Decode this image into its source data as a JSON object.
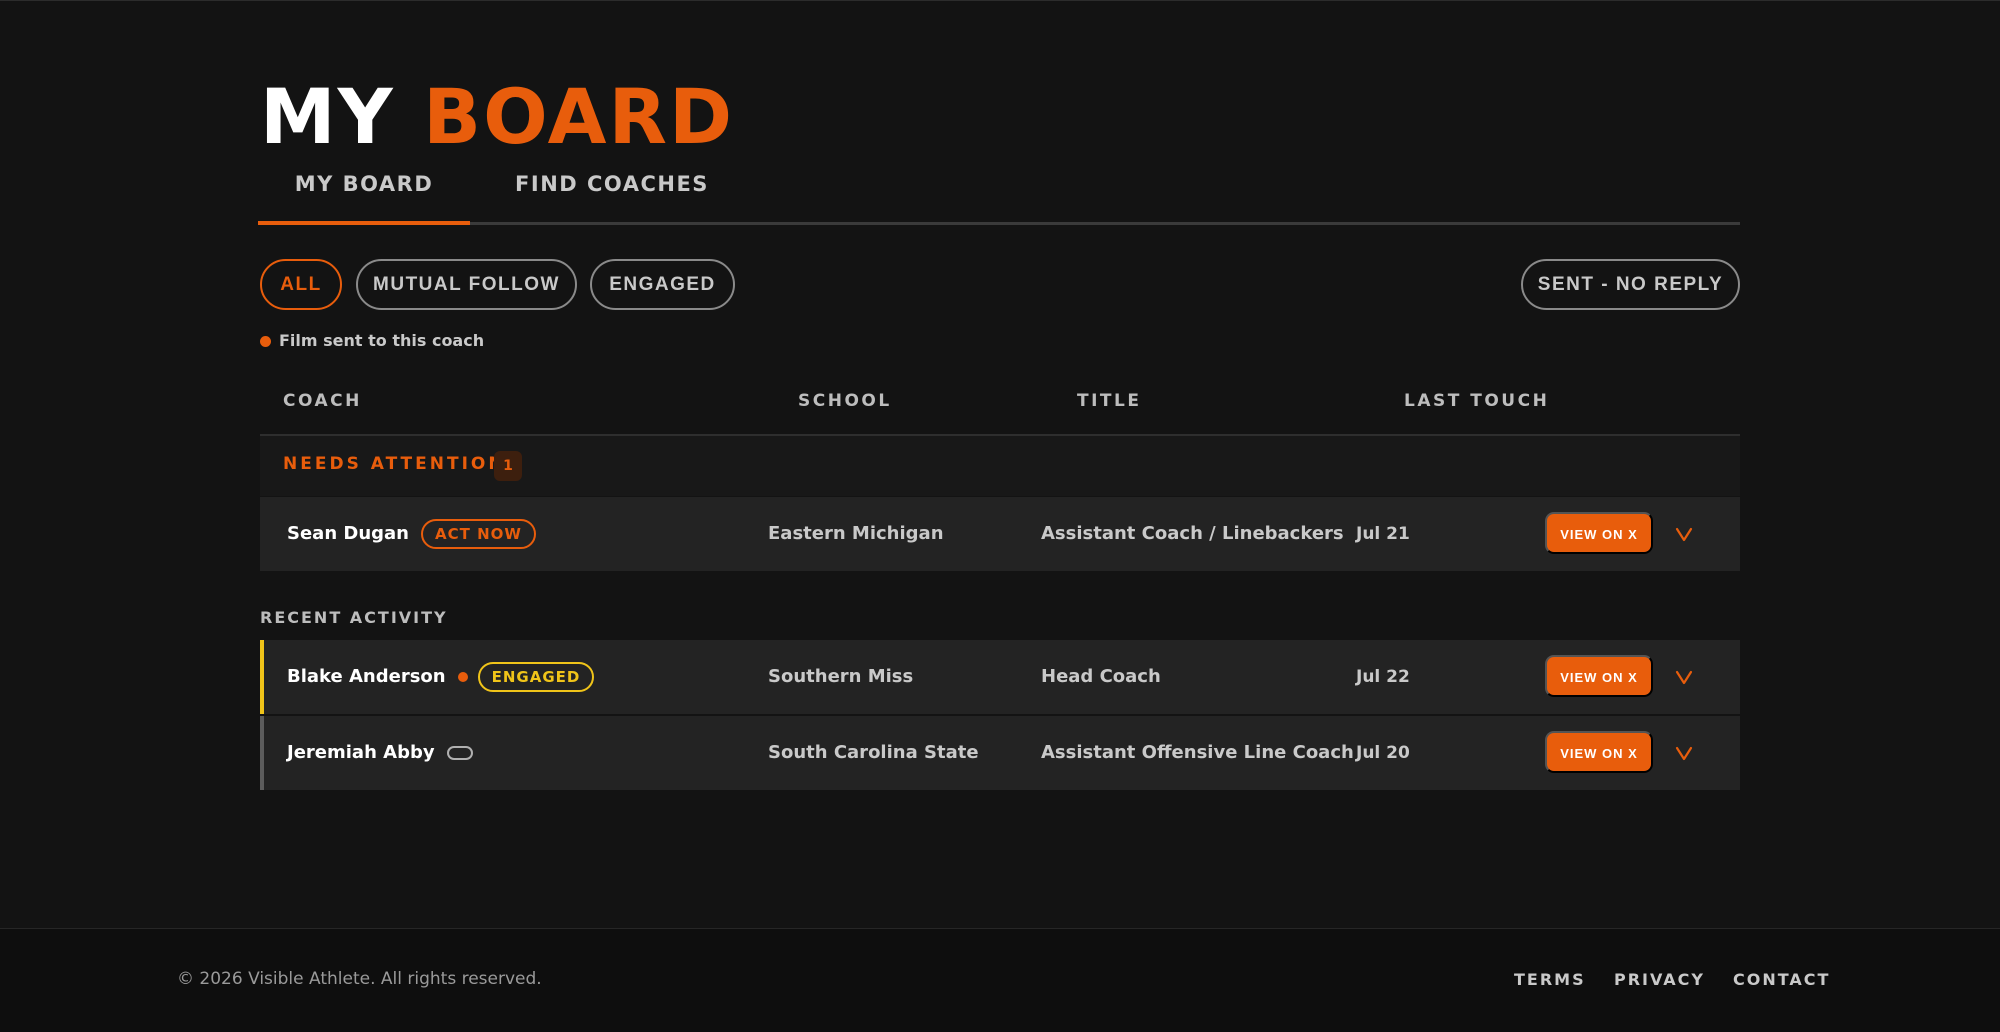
{
  "page": {
    "title_part1": "MY",
    "title_part2": "BOARD"
  },
  "tabs": [
    {
      "label": "MY BOARD",
      "active": true
    },
    {
      "label": "FIND COACHES",
      "active": false
    }
  ],
  "filters": [
    {
      "label": "ALL",
      "active": true
    },
    {
      "label": "MUTUAL FOLLOW",
      "active": false
    },
    {
      "label": "ENGAGED",
      "active": false
    },
    {
      "label": "SENT - NO REPLY",
      "active": false
    }
  ],
  "legend": {
    "text": "Film sent to this coach"
  },
  "table": {
    "headers": [
      "COACH",
      "SCHOOL",
      "TITLE",
      "LAST TOUCH"
    ]
  },
  "groups": {
    "needs_attention": {
      "label": "NEEDS ATTENTION",
      "count": "1",
      "rows": [
        {
          "name": "Sean Dugan",
          "badge": "ACT NOW",
          "school": "Eastern Michigan",
          "title": "Assistant Coach / Linebackers",
          "last_touch": "Jul 21",
          "action": "VIEW ON X"
        }
      ]
    },
    "recent_activity": {
      "label": "RECENT ACTIVITY",
      "rows": [
        {
          "name": "Blake Anderson",
          "film_sent": true,
          "badge": "ENGAGED",
          "school": "Southern Miss",
          "title": "Head Coach",
          "last_touch": "Jul 22",
          "action": "VIEW ON X"
        },
        {
          "name": "Jeremiah Abby",
          "film_sent": false,
          "badge": "",
          "school": "South Carolina State",
          "title": "Assistant Offensive Line Coach",
          "last_touch": "Jul 20",
          "action": "VIEW ON X"
        }
      ]
    }
  },
  "footer": {
    "copyright": "© 2026 Visible Athlete. All rights reserved.",
    "links": [
      "TERMS",
      "PRIVACY",
      "CONTACT"
    ]
  },
  "colors": {
    "accent": "#e85d0c",
    "engaged": "#f0c419",
    "background": "#131313",
    "row": "#232323"
  },
  "icons": {
    "expand": "chevron-down-icon",
    "film": "film-dot-icon"
  }
}
